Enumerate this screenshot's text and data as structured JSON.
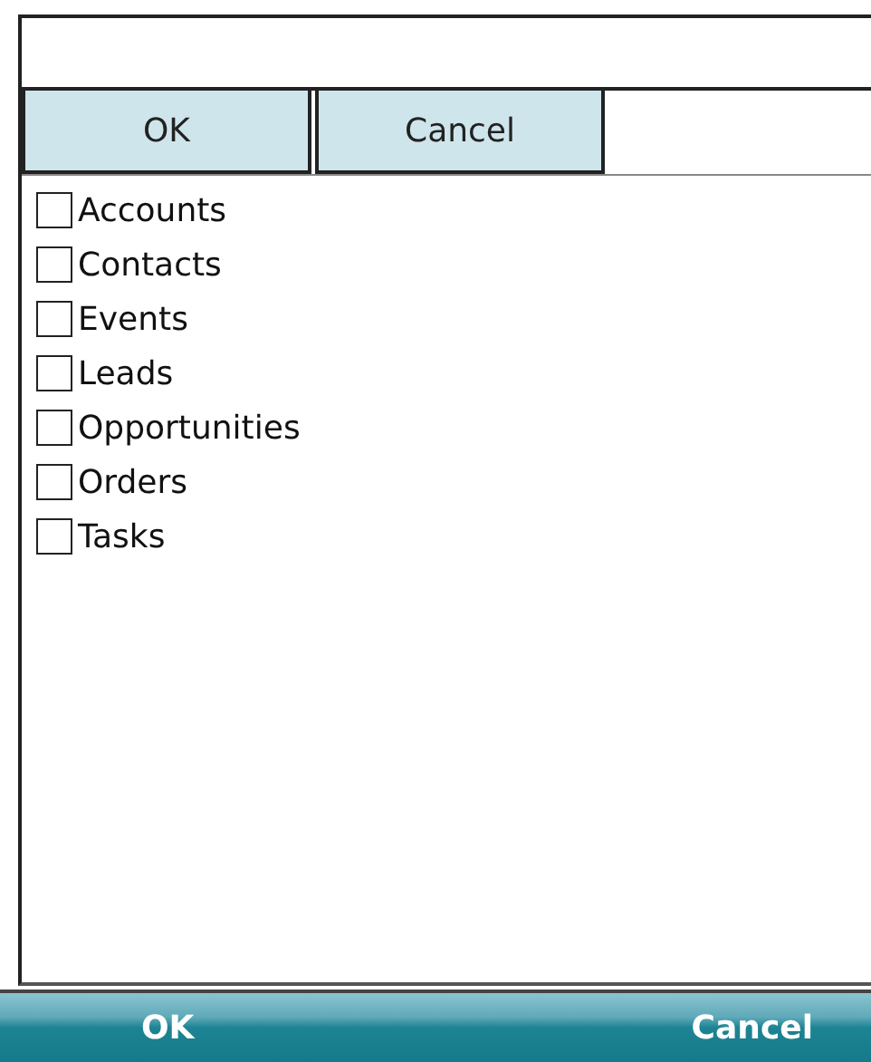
{
  "buttons": [
    "OK",
    "Cancel"
  ],
  "items": [
    {
      "label": "Accounts",
      "checked": false
    },
    {
      "label": "Contacts",
      "checked": false
    },
    {
      "label": "Events",
      "checked": false
    },
    {
      "label": "Leads",
      "checked": false
    },
    {
      "label": "Opportunities",
      "checked": false
    },
    {
      "label": "Orders",
      "checked": false
    },
    {
      "label": "Tasks",
      "checked": false
    }
  ],
  "softkeys": [
    "OK",
    "Cancel"
  ]
}
